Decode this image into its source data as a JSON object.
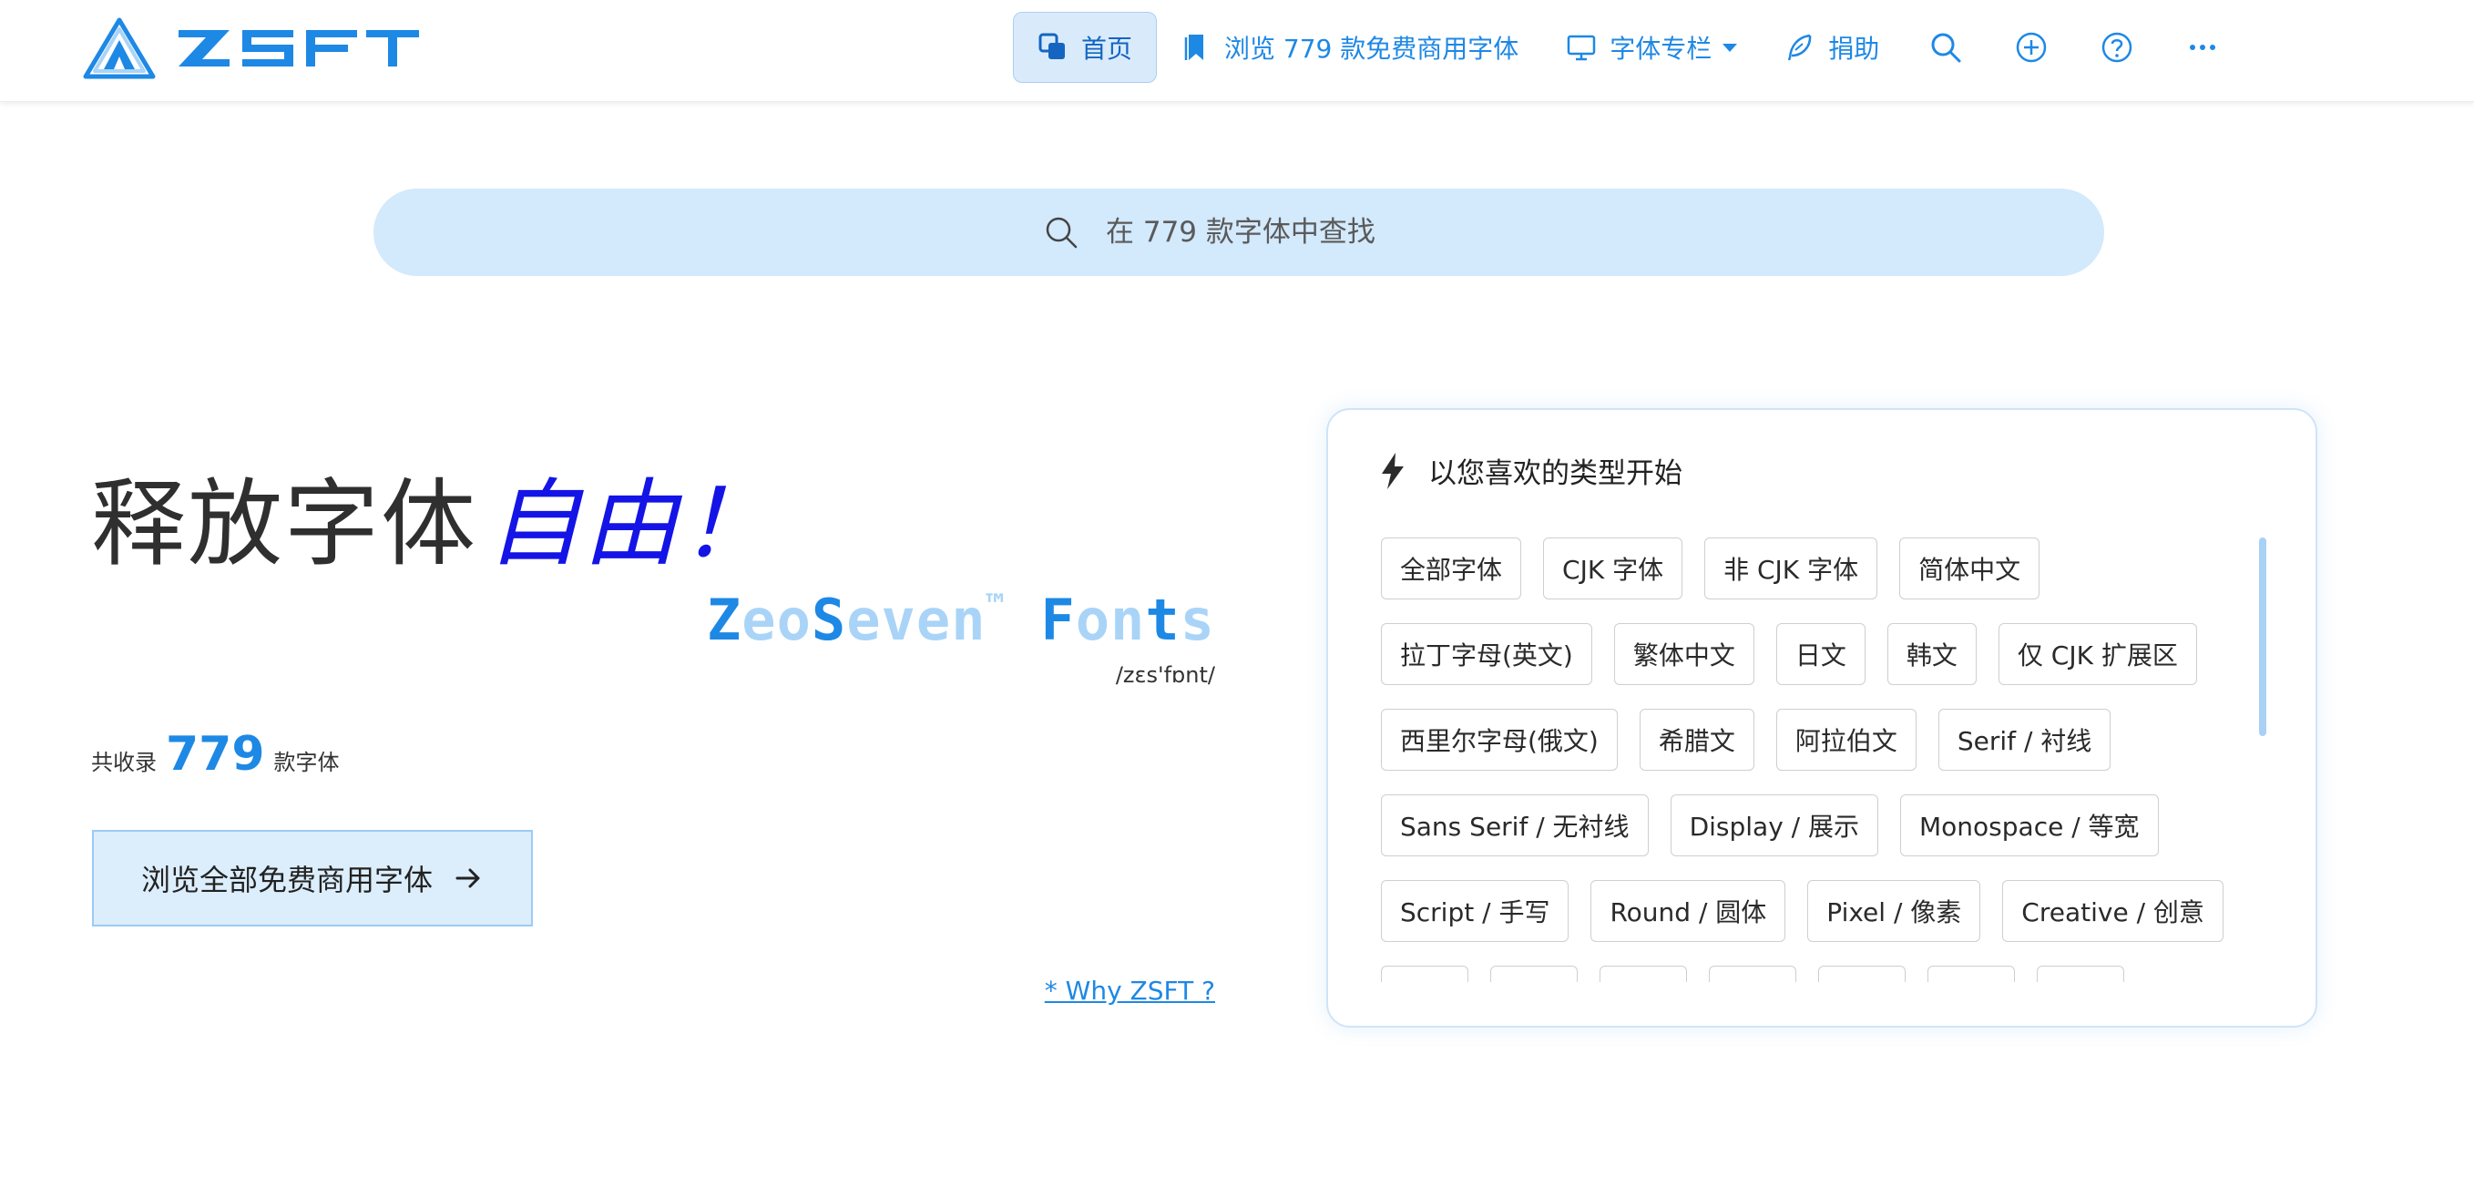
{
  "brand": {
    "name": "ZSFT"
  },
  "nav": {
    "home": "首页",
    "browse": "浏览 779 款免费商用字体",
    "columns": "字体专栏",
    "donate": "捐助"
  },
  "search": {
    "placeholder": "在 779 款字体中查找"
  },
  "hero": {
    "title_main": "释放字体",
    "title_accent": "自由！",
    "brand_z": "Z",
    "brand_eo": "eo",
    "brand_s": "S",
    "brand_even": "even",
    "brand_tm": "™",
    "brand_f": "F",
    "brand_on": "on",
    "brand_t": "t",
    "brand_s2": "s",
    "phonetic": "/zɛs'fɒnt/",
    "count_prefix": "共收录",
    "count_value": "779",
    "count_suffix": "款字体",
    "browse_button": "浏览全部免费商用字体",
    "why_link": "* Why ZSFT ?"
  },
  "panel": {
    "heading": "以您喜欢的类型开始",
    "rows": [
      [
        "全部字体",
        "CJK 字体",
        "非 CJK 字体",
        "简体中文"
      ],
      [
        "拉丁字母(英文)",
        "繁体中文",
        "日文",
        "韩文",
        "仅 CJK 扩展区"
      ],
      [
        "西里尔字母(俄文)",
        "希腊文",
        "阿拉伯文",
        "Serif / 衬线"
      ],
      [
        "Sans Serif / 无衬线",
        "Display / 展示",
        "Monospace / 等宽"
      ],
      [
        "Script / 手写",
        "Round / 圆体",
        "Pixel / 像素",
        "Creative / 创意"
      ]
    ]
  },
  "colors": {
    "accent": "#1e88e5",
    "accent_light": "#a9d4f7",
    "search_bg": "#d3e9fc",
    "hero_accent": "#1414e6"
  }
}
